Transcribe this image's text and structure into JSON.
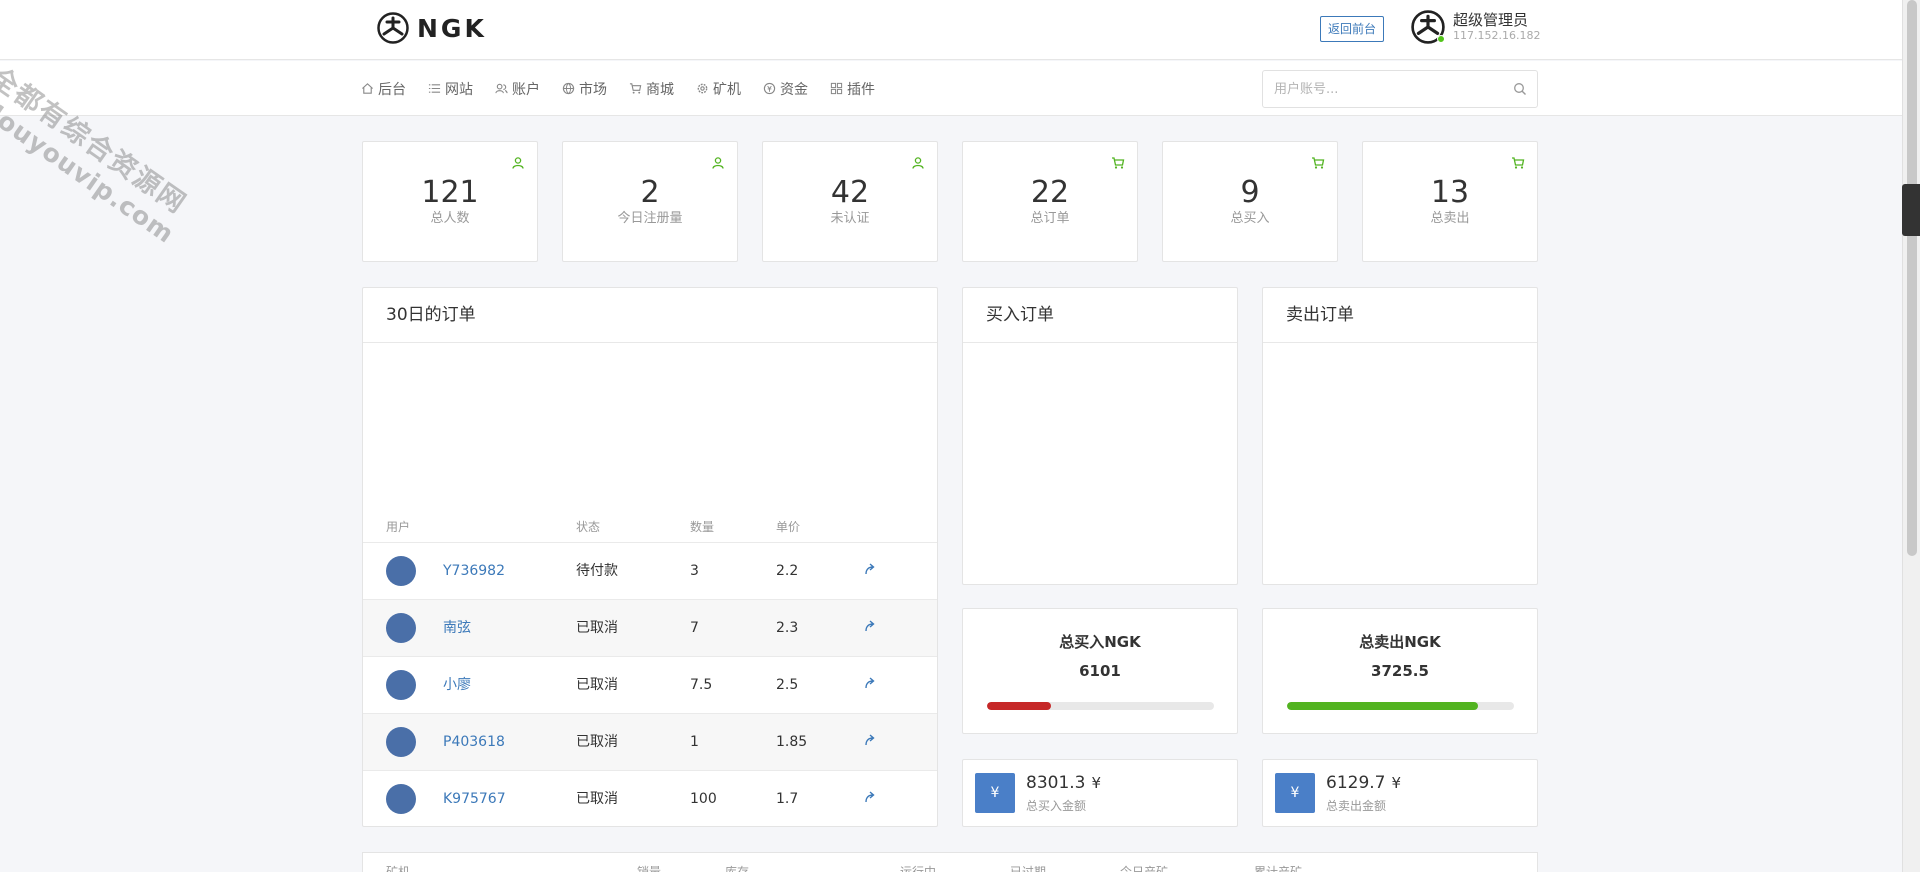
{
  "header": {
    "brand": "NGK",
    "front_button": "返回前台",
    "admin_name": "超级管理员",
    "admin_ip": "117.152.16.182"
  },
  "nav": [
    {
      "label": "后台",
      "icon": "home-icon"
    },
    {
      "label": "网站",
      "icon": "list-icon"
    },
    {
      "label": "账户",
      "icon": "users-icon"
    },
    {
      "label": "市场",
      "icon": "globe-icon"
    },
    {
      "label": "商城",
      "icon": "cart-icon"
    },
    {
      "label": "矿机",
      "icon": "gear-icon"
    },
    {
      "label": "资金",
      "icon": "coin-icon"
    },
    {
      "label": "插件",
      "icon": "grid-icon"
    }
  ],
  "search": {
    "placeholder": "用户账号..."
  },
  "stats": [
    {
      "value": "121",
      "label": "总人数",
      "icon": "user-icon"
    },
    {
      "value": "2",
      "label": "今日注册量",
      "icon": "user-icon"
    },
    {
      "value": "42",
      "label": "未认证",
      "icon": "user-icon"
    },
    {
      "value": "22",
      "label": "总订单",
      "icon": "cart-icon"
    },
    {
      "value": "9",
      "label": "总买入",
      "icon": "cart-icon"
    },
    {
      "value": "13",
      "label": "总卖出",
      "icon": "cart-icon"
    }
  ],
  "orders_panel": {
    "title": "30日的订单",
    "columns": [
      "用户",
      "状态",
      "数量",
      "单价"
    ],
    "rows": [
      {
        "user": "Y736982",
        "status": "待付款",
        "qty": "3",
        "price": "2.2"
      },
      {
        "user": "南弦",
        "status": "已取消",
        "qty": "7",
        "price": "2.3"
      },
      {
        "user": "小廖",
        "status": "已取消",
        "qty": "7.5",
        "price": "2.5"
      },
      {
        "user": "P403618",
        "status": "已取消",
        "qty": "1",
        "price": "1.85"
      },
      {
        "user": "K975767",
        "status": "已取消",
        "qty": "100",
        "price": "1.7"
      }
    ]
  },
  "buy_panel": {
    "title": "买入订单"
  },
  "sell_panel": {
    "title": "卖出订单"
  },
  "totals": {
    "buy": {
      "title": "总买入NGK",
      "value": "6101",
      "progress": 0.28,
      "color": "#c62828"
    },
    "sell": {
      "title": "总卖出NGK",
      "value": "3725.5",
      "progress": 0.84,
      "color": "#52b320"
    }
  },
  "amounts": {
    "buy": {
      "symbol": "¥",
      "value": "8301.3",
      "currency": "¥",
      "label": "总买入金额"
    },
    "sell": {
      "symbol": "¥",
      "value": "6129.7",
      "currency": "¥",
      "label": "总卖出金额"
    }
  },
  "bottom_table": {
    "columns": [
      "矿机",
      "销量",
      "库存",
      "运行中",
      "已过期",
      "今日产矿",
      "累计产矿"
    ]
  },
  "watermark": {
    "line1": "全都有综合资源网",
    "line2": "douyouvip.com"
  }
}
